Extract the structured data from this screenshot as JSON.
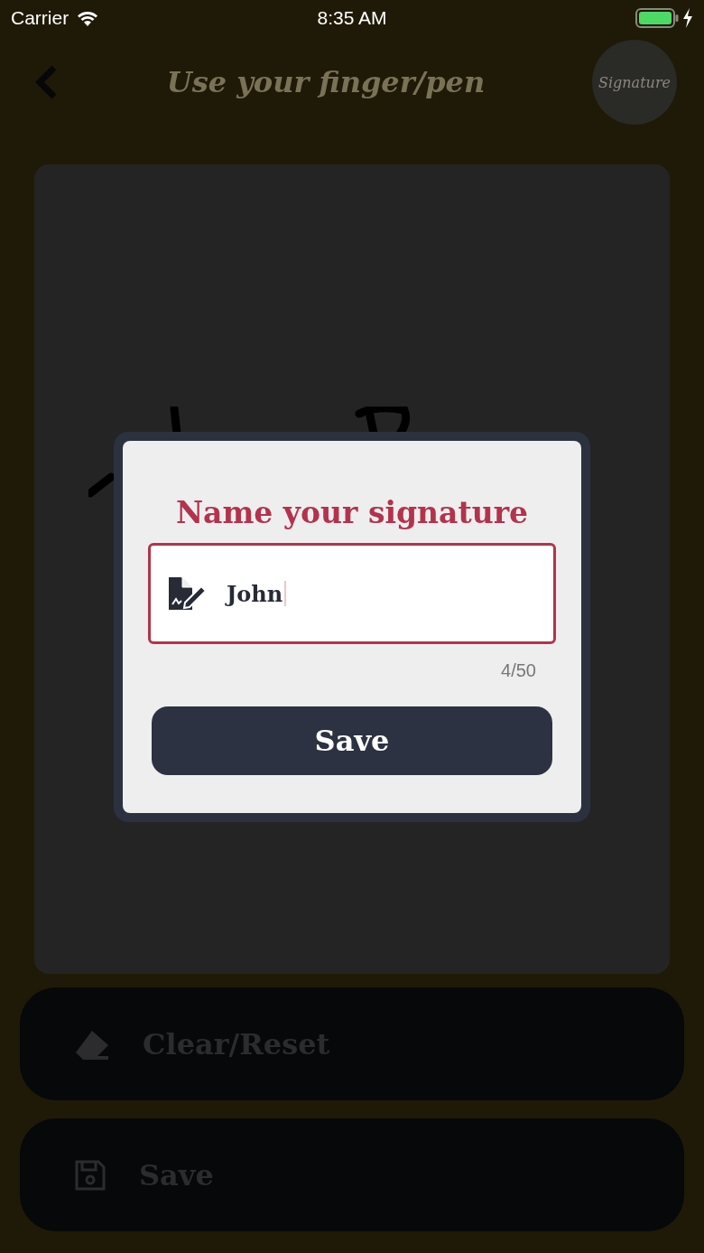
{
  "status_bar": {
    "carrier": "Carrier",
    "time": "8:35 AM"
  },
  "header": {
    "title": "Use your finger/pen",
    "logo_text": "Signature"
  },
  "dialog": {
    "title": "Name your signature",
    "field_value": "John",
    "counter": "4/50",
    "button": "Save"
  },
  "actions": [
    {
      "kind": "clear",
      "label": "Clear/Reset"
    },
    {
      "kind": "save",
      "label": "Save"
    }
  ]
}
